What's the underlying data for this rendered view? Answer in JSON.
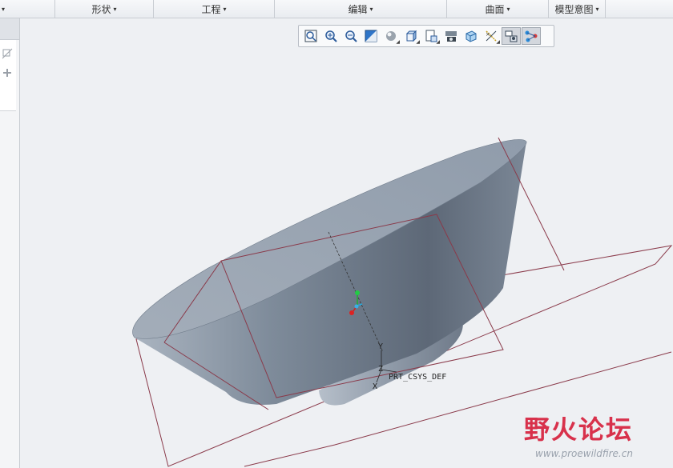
{
  "ribbon": {
    "groups": [
      {
        "label": "形状",
        "caret": "▾"
      },
      {
        "label": "工程",
        "caret": "▾"
      },
      {
        "label": "编辑",
        "caret": "▾"
      },
      {
        "label": "曲面",
        "caret": "▾"
      },
      {
        "label": "模型意图",
        "caret": "▾"
      }
    ],
    "first_caret": "▾"
  },
  "graphics_toolbar": {
    "tools": [
      "refit-icon",
      "zoom-in-icon",
      "zoom-out-icon",
      "repaint-icon",
      "display-style-icon",
      "saved-orientations-icon",
      "view-manager-icon",
      "perspective-view-icon",
      "section-icon",
      "datum-display-icon",
      "annotation-display-icon",
      "spin-center-icon"
    ]
  },
  "model": {
    "csys_label": "PRT_CSYS_DEF",
    "axis_labels": {
      "y": "Y",
      "z": "Z",
      "x": "X"
    },
    "body_color": "#8a97a6",
    "datum_color": "#8a3a4a"
  },
  "watermark": {
    "title": "野火论坛",
    "url": "www.proewildfire.cn"
  }
}
